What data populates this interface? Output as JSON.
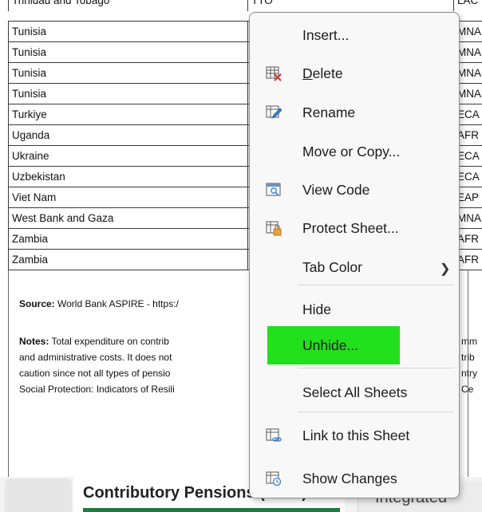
{
  "table": {
    "top_partial": {
      "country": "Trinidad and Tobago",
      "code": "TTO",
      "region": "LAC"
    },
    "rows": [
      {
        "country": "Tunisia",
        "region": "MNA"
      },
      {
        "country": "Tunisia",
        "region": "MNA"
      },
      {
        "country": "Tunisia",
        "region": "MNA"
      },
      {
        "country": "Tunisia",
        "region": "MNA"
      },
      {
        "country": "Turkiye",
        "region": "ECA"
      },
      {
        "country": "Uganda",
        "region": "AFR"
      },
      {
        "country": "Ukraine",
        "region": "ECA"
      },
      {
        "country": "Uzbekistan",
        "region": "ECA"
      },
      {
        "country": "Viet Nam",
        "region": "EAP"
      },
      {
        "country": "West Bank and Gaza",
        "region": "MNA"
      },
      {
        "country": "Zambia",
        "region": "AFR"
      },
      {
        "country": "Zambia",
        "region": "AFR"
      }
    ]
  },
  "notes": {
    "source_label": "Source:",
    "source_text": " World Bank ASPIRE  - https:/",
    "notes_label": "Notes:",
    "line1": " Total expenditure on contrib",
    "line2": "and administrative costs. It does not",
    "line3": "caution since not all types of pensio",
    "line4": "Social Protection: Indicators of Resili",
    "right1": "mm",
    "right2": "trib",
    "right3": "ntry",
    "right4": "Ce"
  },
  "tabs": {
    "active": "Contributory Pensions (Total)",
    "next": "Integrated"
  },
  "context_menu": {
    "insert": "Insert...",
    "delete": "Delete",
    "rename": "Rename",
    "move_or_copy": "Move or Copy...",
    "view_code": "View Code",
    "protect_sheet": "Protect Sheet...",
    "tab_color": "Tab Color",
    "hide": "Hide",
    "unhide": "Unhide...",
    "select_all_sheets": "Select All Sheets",
    "link_to_sheet": "Link to this Sheet",
    "show_changes": "Show Changes"
  },
  "colors": {
    "highlight": "#22e01b",
    "active_tab_underline": "#1e7a3e"
  }
}
